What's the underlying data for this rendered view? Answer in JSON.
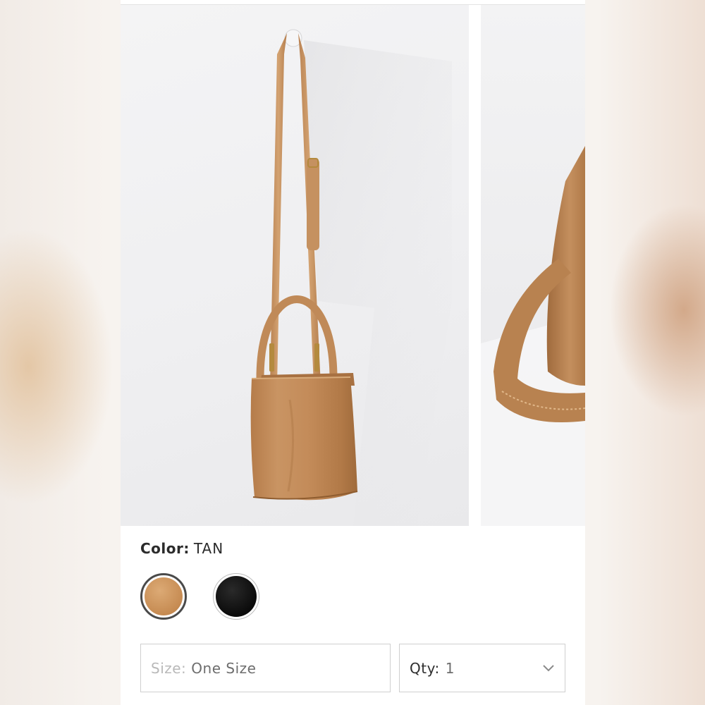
{
  "product": {
    "color_label": "Color:",
    "color_value": "TAN",
    "swatches": [
      {
        "name": "tan",
        "hex": "#c98d55",
        "selected": true
      },
      {
        "name": "black",
        "hex": "#0f0f0f",
        "selected": false
      }
    ],
    "size_label": "Size:",
    "size_value": "One Size",
    "qty_label": "Qty:",
    "qty_value": "1",
    "qty_icon": "chevron-down-icon"
  },
  "colors": {
    "bag": "#c48f5e",
    "border": "#cfcfcf",
    "text": "#2b2b2b"
  }
}
